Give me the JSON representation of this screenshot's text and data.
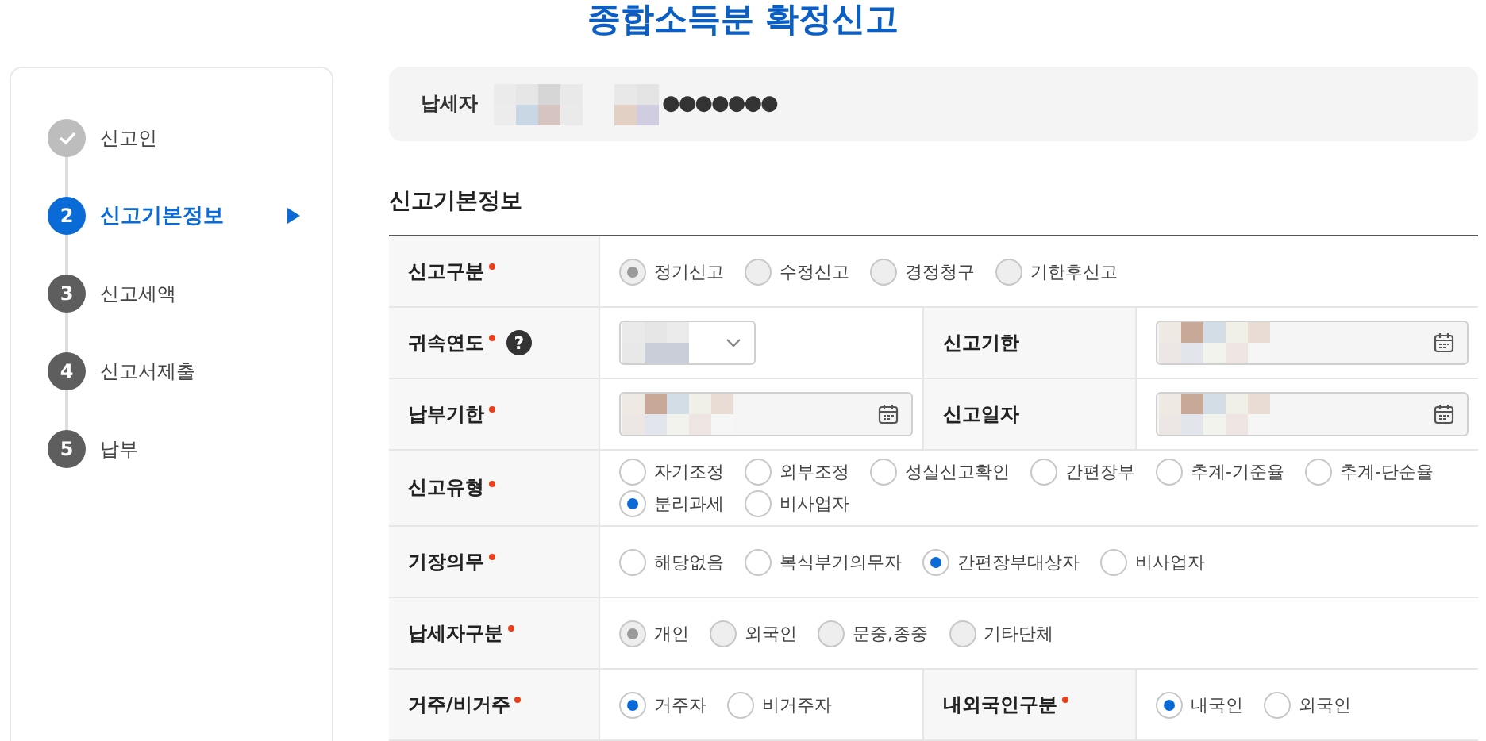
{
  "title": "종합소득분 확정신고",
  "steps": [
    {
      "label": "신고인",
      "completed": true,
      "selected": false
    },
    {
      "number": "2",
      "label": "신고기본정보",
      "completed": false,
      "selected": true
    },
    {
      "number": "3",
      "label": "신고세액",
      "completed": false,
      "selected": false
    },
    {
      "number": "4",
      "label": "신고서제출",
      "completed": false,
      "selected": false
    },
    {
      "number": "5",
      "label": "납부",
      "completed": false,
      "selected": false
    }
  ],
  "taxpayer": {
    "label": "납세자",
    "masked_id": "●●●●●●●"
  },
  "section_title": "신고기본정보",
  "rows": [
    {
      "cells": [
        {
          "label": "신고구분",
          "required": true,
          "control": {
            "kind": "radio",
            "disabled": true,
            "options": [
              {
                "label": "정기신고",
                "selected": true
              },
              {
                "label": "수정신고",
                "selected": false
              },
              {
                "label": "경정청구",
                "selected": false
              },
              {
                "label": "기한후신고",
                "selected": false
              }
            ]
          }
        }
      ]
    },
    {
      "cells": [
        {
          "label": "귀속연도",
          "required": true,
          "help": "?",
          "control": {
            "kind": "select"
          }
        },
        {
          "label": "신고기한",
          "required": false,
          "control": {
            "kind": "date"
          }
        }
      ]
    },
    {
      "cells": [
        {
          "label": "납부기한",
          "required": true,
          "control": {
            "kind": "date"
          }
        },
        {
          "label": "신고일자",
          "required": false,
          "control": {
            "kind": "date"
          }
        }
      ]
    },
    {
      "cells": [
        {
          "label": "신고유형",
          "required": true,
          "control": {
            "kind": "radio",
            "disabled": false,
            "options": [
              {
                "label": "자기조정",
                "selected": false
              },
              {
                "label": "외부조정",
                "selected": false
              },
              {
                "label": "성실신고확인",
                "selected": false
              },
              {
                "label": "간편장부",
                "selected": false
              },
              {
                "label": "추계-기준율",
                "selected": false
              },
              {
                "label": "추계-단순율",
                "selected": false
              },
              {
                "label": "분리과세",
                "selected": true
              },
              {
                "label": "비사업자",
                "selected": false
              }
            ]
          }
        }
      ]
    },
    {
      "cells": [
        {
          "label": "기장의무",
          "required": true,
          "control": {
            "kind": "radio",
            "disabled": false,
            "options": [
              {
                "label": "해당없음",
                "selected": false
              },
              {
                "label": "복식부기의무자",
                "selected": false
              },
              {
                "label": "간편장부대상자",
                "selected": true
              },
              {
                "label": "비사업자",
                "selected": false
              }
            ]
          }
        }
      ]
    },
    {
      "cells": [
        {
          "label": "납세자구분",
          "required": true,
          "control": {
            "kind": "radio",
            "disabled": true,
            "options": [
              {
                "label": "개인",
                "selected": true
              },
              {
                "label": "외국인",
                "selected": false
              },
              {
                "label": "문중,종중",
                "selected": false
              },
              {
                "label": "기타단체",
                "selected": false
              }
            ]
          }
        }
      ]
    },
    {
      "cells": [
        {
          "label": "거주/비거주",
          "required": true,
          "control": {
            "kind": "radio",
            "disabled": false,
            "options": [
              {
                "label": "거주자",
                "selected": true
              },
              {
                "label": "비거주자",
                "selected": false
              }
            ]
          }
        },
        {
          "label": "내외국인구분",
          "required": true,
          "control": {
            "kind": "radio",
            "disabled": false,
            "options": [
              {
                "label": "내국인",
                "selected": true
              },
              {
                "label": "외국인",
                "selected": false
              }
            ]
          }
        }
      ]
    }
  ]
}
